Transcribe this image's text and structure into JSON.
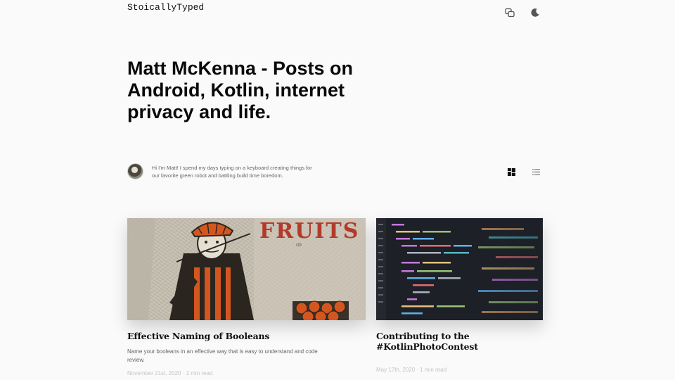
{
  "header": {
    "logo": "StoicallyTyped",
    "icons": [
      "translate-icon",
      "moon-icon"
    ]
  },
  "hero": {
    "title": "Matt McKenna - Posts on Android, Kotlin, internet privacy and life."
  },
  "author": {
    "bio": "Hi I'm Matt! I spend my days typing on a keyboard creating things for our favorite green robot and battling build time boredom."
  },
  "view_toggle": {
    "active": "grid",
    "icons": [
      "grid-view-icon",
      "list-view-icon"
    ]
  },
  "posts": [
    {
      "title": "Effective Naming of Booleans",
      "excerpt": "Name your booleans in an effective way that is easy to understand and code review.",
      "meta": "November 21st, 2020 · 1 min read",
      "image_text": "FRUITS"
    },
    {
      "title": "Contributing to the #KotlinPhotoContest",
      "excerpt": "",
      "meta": "May 17th, 2020 · 1 min read"
    }
  ],
  "colors": {
    "background": "#fafafa",
    "text": "#111111",
    "muted": "#666666",
    "meta": "#c4c4c4"
  }
}
